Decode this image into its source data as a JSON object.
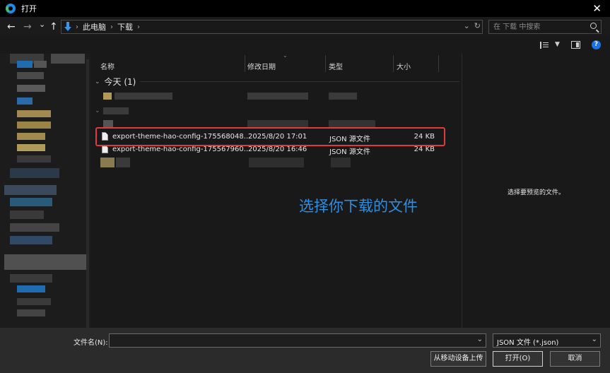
{
  "window": {
    "title": "打开",
    "close_glyph": "✕"
  },
  "nav": {
    "back_glyph": "←",
    "forward_glyph": "→",
    "recent_glyph": "⌄",
    "up_glyph": "↑",
    "breadcrumb": [
      "此电脑",
      "下载"
    ],
    "search_placeholder": "在 下载 中搜索"
  },
  "columns": {
    "name": "名称",
    "modified": "修改日期",
    "type": "类型",
    "size": "大小"
  },
  "group": {
    "label": "今天 (1)"
  },
  "files": [
    {
      "name": "export-theme-hao-config-175568048...",
      "modified": "2025/8/20 17:01",
      "type": "JSON 源文件",
      "size": "24 KB"
    },
    {
      "name": "export-theme-hao-config-175567960...",
      "modified": "2025/8/20 16:46",
      "type": "JSON 源文件",
      "size": "24 KB"
    }
  ],
  "annotation": "选择你下载的文件",
  "preview_text": "选择要预览的文件。",
  "footer": {
    "filename_label": "文件名(N):",
    "filename_value": "",
    "filetype": "JSON 文件 (*.json)",
    "upload_button": "从移动设备上传",
    "open_button": "打开(O)",
    "cancel_button": "取消"
  },
  "colors": {
    "accent": "#2e8ee0",
    "highlight": "#e03a3a",
    "help": "#1a73e8"
  }
}
